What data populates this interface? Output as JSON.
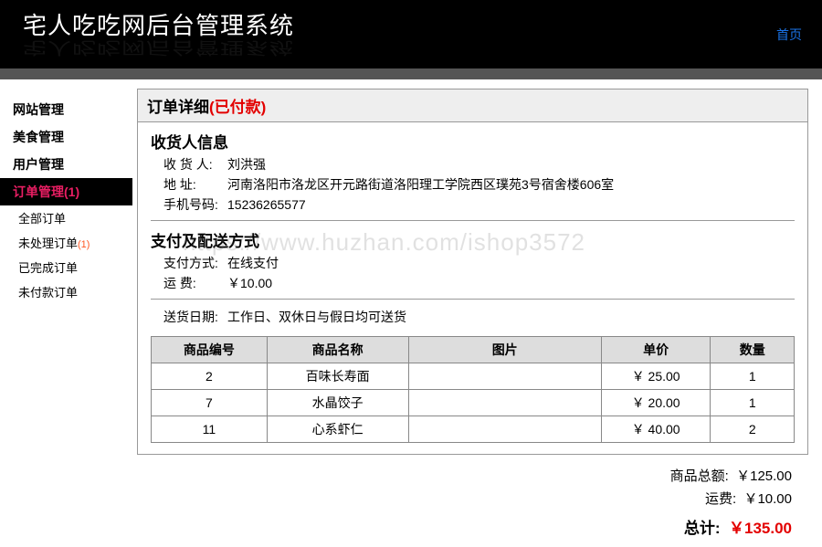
{
  "header": {
    "title": "宅人吃吃网后台管理系统",
    "home_link": "首页"
  },
  "sidebar": {
    "groups": [
      {
        "label": "网站管理",
        "active": false
      },
      {
        "label": "美食管理",
        "active": false
      },
      {
        "label": "用户管理",
        "active": false
      },
      {
        "label": "订单管理",
        "count": "(1)",
        "active": true
      }
    ],
    "subs": [
      {
        "label": "全部订单",
        "badge": ""
      },
      {
        "label": "未处理订单",
        "badge": "(1)"
      },
      {
        "label": "已完成订单",
        "badge": ""
      },
      {
        "label": "未付款订单",
        "badge": ""
      }
    ]
  },
  "panel": {
    "title": "订单详细",
    "status": "(已付款)"
  },
  "recipient": {
    "section_title": "收货人信息",
    "name_label": "收 货 人:",
    "name": "刘洪强",
    "addr_label": "地 址:",
    "addr": "河南洛阳市洛龙区开元路街道洛阳理工学院西区璞苑3号宿舍楼606室",
    "phone_label": "手机号码:",
    "phone": "15236265577"
  },
  "payship": {
    "section_title": "支付及配送方式",
    "pay_label": "支付方式:",
    "pay": "在线支付",
    "ship_label": "运 费:",
    "ship": "￥10.00",
    "date_label": "送货日期:",
    "date": "工作日、双休日与假日均可送货"
  },
  "columns": {
    "c1": "商品编号",
    "c2": "商品名称",
    "c3": "图片",
    "c4": "单价",
    "c5": "数量"
  },
  "items": [
    {
      "id": "2",
      "name": "百味长寿面",
      "img": "",
      "price": "￥ 25.00",
      "qty": "1"
    },
    {
      "id": "7",
      "name": "水晶饺子",
      "img": "",
      "price": "￥ 20.00",
      "qty": "1"
    },
    {
      "id": "11",
      "name": "心系虾仁",
      "img": "",
      "price": "￥ 40.00",
      "qty": "2"
    }
  ],
  "totals": {
    "subtotal_label": "商品总额:",
    "subtotal": "￥125.00",
    "shipping_label": "运费:",
    "shipping": "￥10.00",
    "grand_label": "总计:",
    "grand": "￥135.00"
  },
  "watermark": "https://www.huzhan.com/ishop3572"
}
